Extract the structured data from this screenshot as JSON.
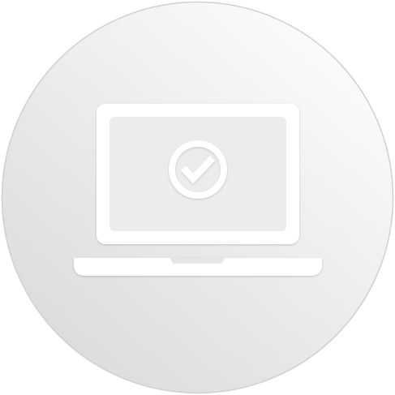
{
  "badge": {
    "icon": "laptop-check-icon",
    "colors": {
      "circle_light": "#fbfbfb",
      "circle_dark": "#dcdcdc",
      "circle_border": "#d0d0d0",
      "icon_fill": "#ffffff",
      "screen_fill": "#ececec"
    }
  }
}
